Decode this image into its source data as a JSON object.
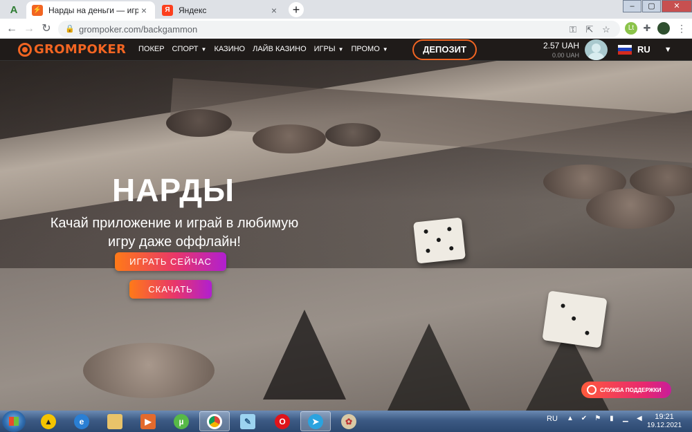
{
  "browser": {
    "tabs": [
      {
        "title": "Нарды на деньги — играть в на",
        "favicon": "grompoker-favicon",
        "active": true
      },
      {
        "title": "Яндекс",
        "favicon": "yandex-favicon",
        "active": false
      }
    ],
    "address": "grompoker.com/backgammon"
  },
  "site": {
    "logo_text": "GROMPOKER",
    "nav": [
      {
        "label": "ПОКЕР",
        "dropdown": false
      },
      {
        "label": "СПОРТ",
        "dropdown": true
      },
      {
        "label": "КАЗИНО",
        "dropdown": false
      },
      {
        "label": "ЛАЙВ КАЗИНО",
        "dropdown": false
      },
      {
        "label": "ИГРЫ",
        "dropdown": true
      },
      {
        "label": "ПРОМО",
        "dropdown": true
      }
    ],
    "deposit_label": "ДЕПОЗИТ",
    "balance": "2.57 UAH",
    "bonus_balance": "0.00 UAH",
    "language": "RU",
    "colors": {
      "brand": "#f26522",
      "header_bg": "#1f1b19"
    }
  },
  "hero": {
    "title": "НАРДЫ",
    "subtitle": "Качай приложение и играй в любимую игру даже оффлайн!",
    "play_label": "ИГРАТЬ СЕЙЧАС",
    "download_label": "СКАЧАТЬ",
    "support_label": "СЛУЖБА ПОДДЕРЖКИ"
  },
  "taskbar": {
    "apps": [
      "aimp-icon",
      "internet-explorer-icon",
      "file-explorer-icon",
      "media-player-icon",
      "utorrent-icon",
      "chrome-icon",
      "notepad-icon",
      "opera-icon",
      "telegram-icon",
      "paint-icon"
    ],
    "language": "RU",
    "time": "19:21",
    "date": "19.12.2021"
  }
}
